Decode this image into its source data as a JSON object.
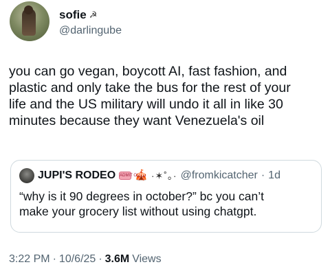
{
  "author": {
    "display_name": "sofie",
    "name_emoji": "☭",
    "handle": "@darlingube"
  },
  "tweet": {
    "text": "you can go vegan, boycott AI, fast fashion, and\nplastic and only take the bus for the rest of your\nlife and the US military will undo it all in like 30\nminutes because they want Venezuela's oil"
  },
  "quote": {
    "display_name": "JUPI'S RODEO",
    "badge_text": "ADMIT ONE",
    "tent_emoji": "🎪",
    "sparkle_text": "·✶˚。·",
    "handle": "@fromkicatcher",
    "separator": "·",
    "time": "1d",
    "text": "“why is it 90 degrees in october?” bc you can’t\nmake your grocery list without using chatgpt."
  },
  "meta": {
    "time": "3:22 PM",
    "sep1": "·",
    "date": "10/6/25",
    "sep2": "·",
    "views_count": "3.6M",
    "views_label": "Views"
  }
}
